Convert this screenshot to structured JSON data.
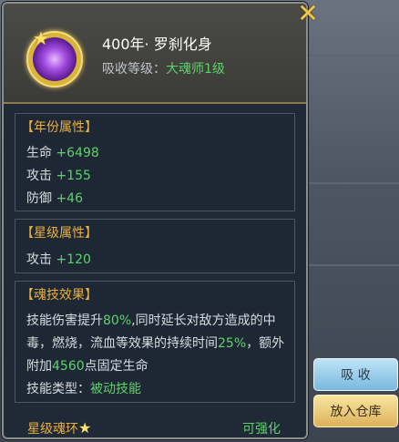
{
  "header": {
    "title": "400年· 罗刹化身",
    "absorb_label": "吸收等级：",
    "absorb_value": "大魂师1级",
    "icon": "purple-soul-ring-icon"
  },
  "year_attributes": {
    "title": "【年份属性】",
    "rows": [
      {
        "label": "生命",
        "value": "+6498"
      },
      {
        "label": "攻击",
        "value": "+155"
      },
      {
        "label": "防御",
        "value": "+46"
      }
    ]
  },
  "star_attributes": {
    "title": "【星级属性】",
    "rows": [
      {
        "label": "攻击",
        "value": "+120"
      }
    ]
  },
  "skill_effect": {
    "title": "【魂技效果】",
    "desc_p1": "技能伤害提升",
    "desc_v1": "80%",
    "desc_p2": ",同时延长对敌方造成的中毒，燃烧，流血等效果的持续时间",
    "desc_v2": "25%",
    "desc_p3": "，额外附加",
    "desc_v3": "4560",
    "desc_p4": "点固定生命",
    "type_label": "技能类型：",
    "type_value": "被动技能"
  },
  "footer": {
    "star_ring_label": "星级魂环",
    "enhance_label": "可强化"
  },
  "buttons": {
    "absorb": "吸 收",
    "store": "放入仓库"
  },
  "colors": {
    "accent_gold": "#e8b040",
    "value_green": "#5ed26a",
    "text": "#d8dcdf"
  }
}
